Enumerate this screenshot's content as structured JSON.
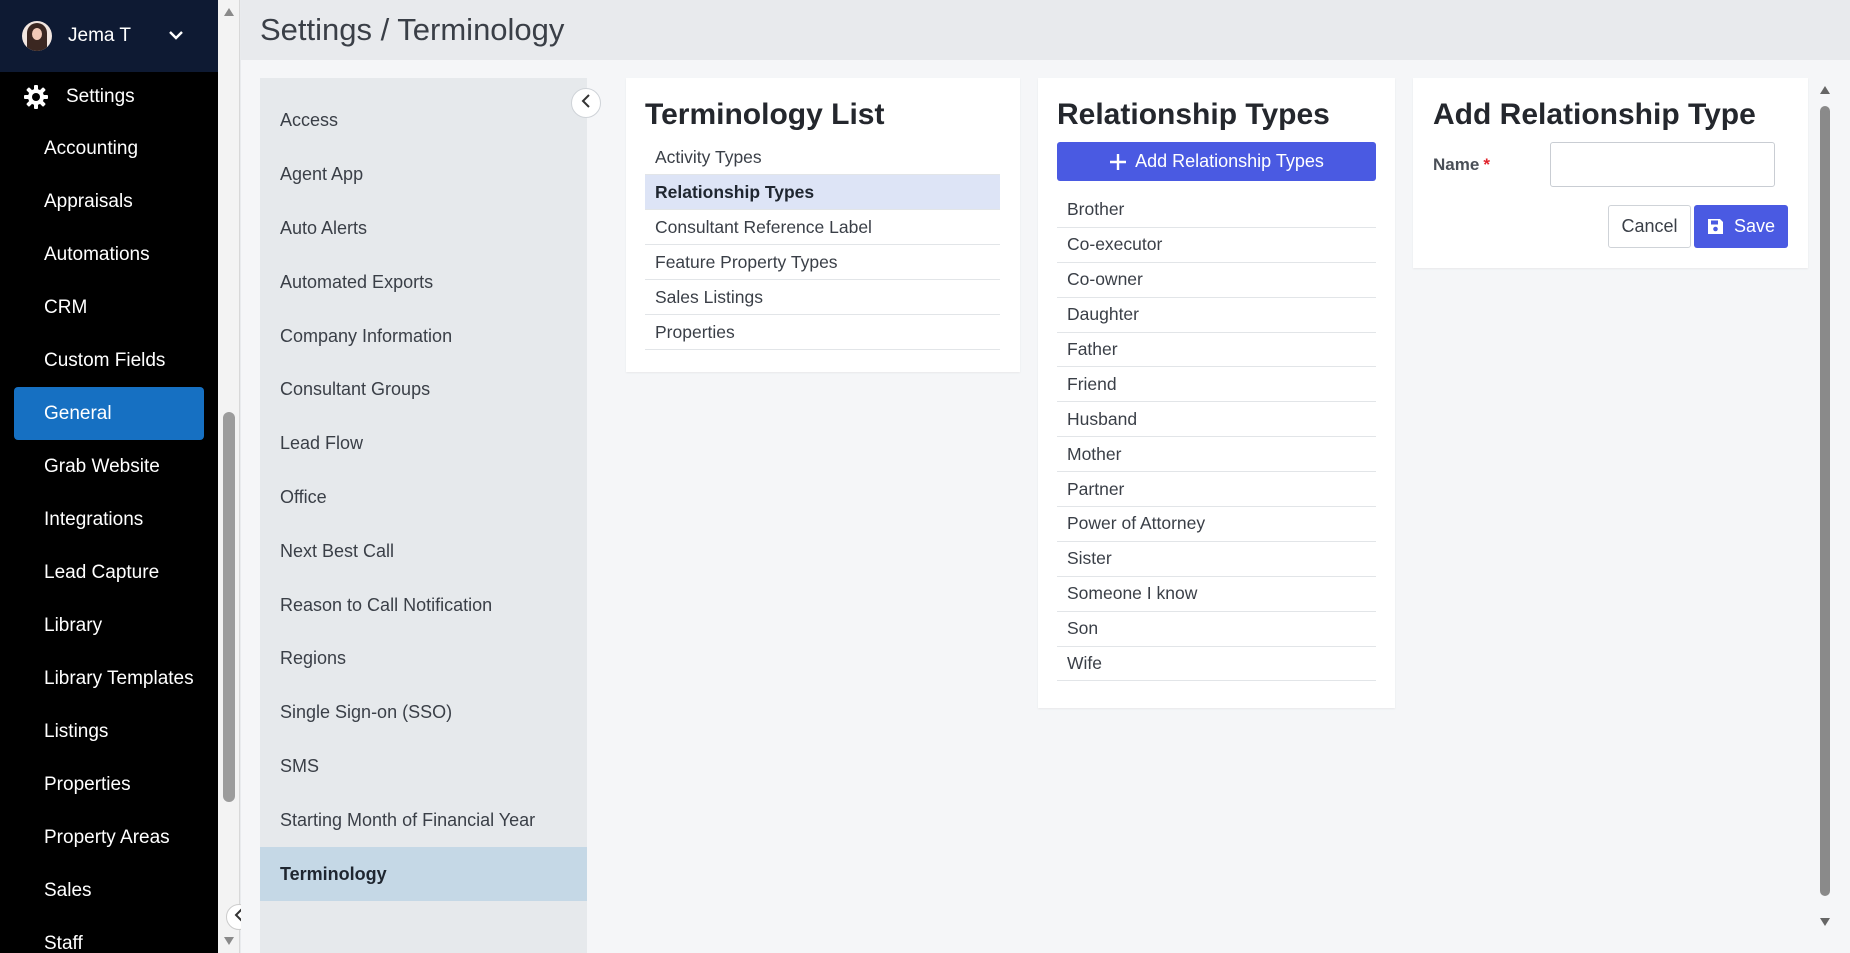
{
  "user": {
    "name": "Jema T"
  },
  "nav": {
    "settings_label": "Settings",
    "items": [
      {
        "label": "Accounting"
      },
      {
        "label": "Appraisals"
      },
      {
        "label": "Automations"
      },
      {
        "label": "CRM"
      },
      {
        "label": "Custom Fields"
      },
      {
        "label": "General",
        "active": true
      },
      {
        "label": "Grab Website"
      },
      {
        "label": "Integrations"
      },
      {
        "label": "Lead Capture"
      },
      {
        "label": "Library"
      },
      {
        "label": "Library Templates"
      },
      {
        "label": "Listings"
      },
      {
        "label": "Properties"
      },
      {
        "label": "Property Areas"
      },
      {
        "label": "Sales"
      },
      {
        "label": "Staff"
      }
    ]
  },
  "header": {
    "title": "Settings / Terminology"
  },
  "submenu": {
    "items": [
      {
        "label": "Access"
      },
      {
        "label": "Agent App"
      },
      {
        "label": "Auto Alerts"
      },
      {
        "label": "Automated Exports"
      },
      {
        "label": "Company Information"
      },
      {
        "label": "Consultant Groups"
      },
      {
        "label": "Lead Flow"
      },
      {
        "label": "Office"
      },
      {
        "label": "Next Best Call"
      },
      {
        "label": "Reason to Call Notification"
      },
      {
        "label": "Regions"
      },
      {
        "label": "Single Sign-on (SSO)"
      },
      {
        "label": "SMS"
      },
      {
        "label": "Starting Month of Financial Year"
      },
      {
        "label": "Terminology",
        "active": true
      }
    ]
  },
  "terminology": {
    "title": "Terminology List",
    "items": [
      {
        "label": "Activity Types"
      },
      {
        "label": "Relationship Types",
        "active": true
      },
      {
        "label": "Consultant Reference Label"
      },
      {
        "label": "Feature Property Types"
      },
      {
        "label": "Sales Listings"
      },
      {
        "label": "Properties"
      }
    ]
  },
  "relationships": {
    "title": "Relationship Types",
    "add_label": "Add Relationship Types",
    "items": [
      "Brother",
      "Co-executor",
      "Co-owner",
      "Daughter",
      "Father",
      "Friend",
      "Husband",
      "Mother",
      "Partner",
      "Power of Attorney",
      "Sister",
      "Someone I know",
      "Son",
      "Wife"
    ]
  },
  "add_form": {
    "title": "Add Relationship Type",
    "name_label": "Name",
    "required_mark": "*",
    "name_value": "",
    "cancel_label": "Cancel",
    "save_label": "Save"
  },
  "colors": {
    "nav_bg": "#000000",
    "user_bar": "#0e1a33",
    "nav_active": "#1670c2",
    "primary": "#4a5ae2",
    "submenu_active": "#c5d8e6",
    "list_active": "#dde4f6"
  },
  "icons": {
    "settings": "gear-icon",
    "user_dropdown": "chevron-down-icon",
    "collapse": "chevron-left-icon",
    "add": "plus-icon",
    "save": "floppy-disk-icon"
  }
}
